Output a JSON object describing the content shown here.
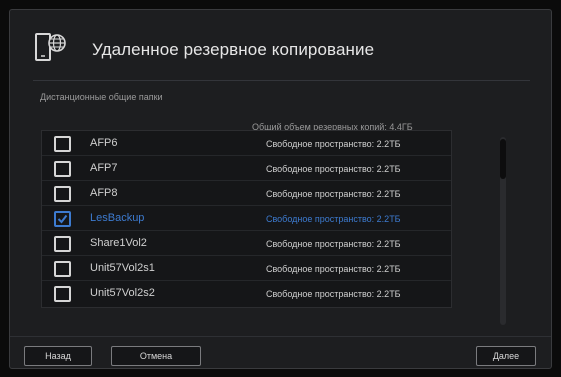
{
  "dialog": {
    "title": "Удаленное резервное копирование",
    "icon": "device-globe-icon"
  },
  "section_label": "Дистанционные общие папки",
  "total_label": "Общий объем резервных копий: 4.4ГБ",
  "shares": [
    {
      "name": "AFP6",
      "free": "Свободное пространство: 2.2ТБ",
      "checked": false
    },
    {
      "name": "AFP7",
      "free": "Свободное пространство: 2.2ТБ",
      "checked": false
    },
    {
      "name": "AFP8",
      "free": "Свободное пространство: 2.2ТБ",
      "checked": false
    },
    {
      "name": "LesBackup",
      "free": "Свободное пространство: 2.2ТБ",
      "checked": true
    },
    {
      "name": "Share1Vol2",
      "free": "Свободное пространство: 2.2ТБ",
      "checked": false
    },
    {
      "name": "Unit57Vol2s1",
      "free": "Свободное пространство: 2.2ТБ",
      "checked": false
    },
    {
      "name": "Unit57Vol2s2",
      "free": "Свободное пространство: 2.2ТБ",
      "checked": false
    }
  ],
  "buttons": {
    "back": "Назад",
    "cancel": "Отмена",
    "next": "Далее"
  },
  "colors": {
    "accent": "#3d7bd0",
    "background": "#1d1e20"
  }
}
